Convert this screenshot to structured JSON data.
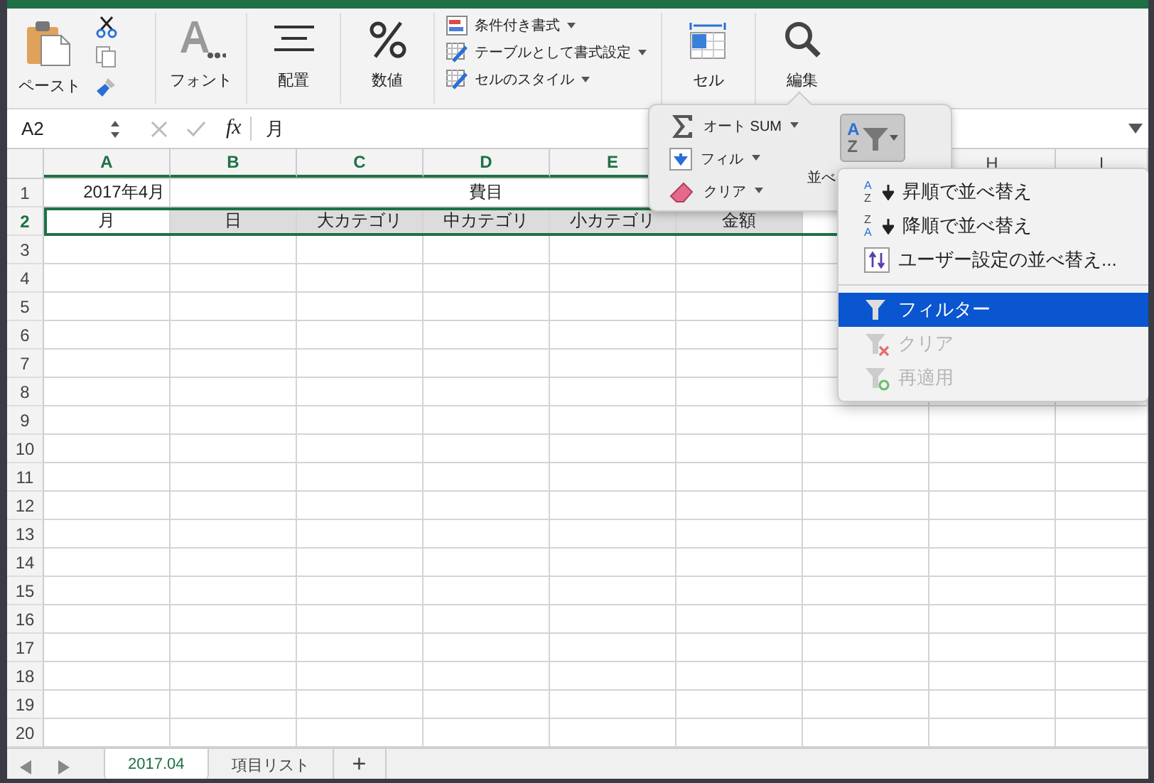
{
  "ribbon": {
    "groups": [
      {
        "kind": "paste",
        "label": "ペースト"
      },
      {
        "kind": "font",
        "label": "フォント"
      },
      {
        "kind": "align",
        "label": "配置"
      },
      {
        "kind": "number",
        "label": "数値"
      },
      {
        "kind": "styles",
        "items": [
          {
            "kind": "conditional",
            "label": "条件付き書式"
          },
          {
            "kind": "table",
            "label": "テーブルとして書式設定"
          },
          {
            "kind": "cellstyle",
            "label": "セルのスタイル"
          }
        ]
      },
      {
        "kind": "cells",
        "label": "セル"
      },
      {
        "kind": "edit",
        "label": "編集"
      }
    ]
  },
  "formula_bar": {
    "name_box": "A2",
    "fx": "fx",
    "value": "月"
  },
  "sheet": {
    "columns": [
      {
        "label": "A",
        "selected": true
      },
      {
        "label": "B",
        "selected": true
      },
      {
        "label": "C",
        "selected": true
      },
      {
        "label": "D",
        "selected": true
      },
      {
        "label": "E",
        "selected": true
      },
      {},
      {},
      {
        "label": "H",
        "selected": false
      },
      {
        "label": "I",
        "selected": false
      }
    ],
    "rows": [
      {
        "number": "1",
        "selected": false,
        "cells": [
          {
            "text": "2017年4月",
            "kind": "right",
            "highlighted": false
          },
          {
            "text": "費目",
            "kind": "merged",
            "highlighted": false
          }
        ]
      },
      {
        "number": "2",
        "selected": true,
        "cells": [
          {
            "text": "月",
            "kind": "center",
            "highlighted": false
          },
          {
            "text": "日",
            "kind": "center",
            "highlighted": true
          },
          {
            "text": "大カテゴリ",
            "kind": "center",
            "highlighted": true
          },
          {
            "text": "中カテゴリ",
            "kind": "center",
            "highlighted": true
          },
          {
            "text": "小カテゴリ",
            "kind": "center",
            "highlighted": true
          },
          {
            "text": "金額",
            "kind": "center",
            "highlighted": true
          }
        ]
      },
      {
        "number": "3",
        "selected": false
      },
      {
        "number": "4",
        "selected": false
      },
      {
        "number": "5",
        "selected": false
      },
      {
        "number": "6",
        "selected": false
      },
      {
        "number": "7",
        "selected": false
      },
      {
        "number": "8",
        "selected": false
      },
      {
        "number": "9",
        "selected": false
      },
      {
        "number": "10",
        "selected": false
      },
      {
        "number": "11",
        "selected": false
      },
      {
        "number": "12",
        "selected": false
      },
      {
        "number": "13",
        "selected": false
      },
      {
        "number": "14",
        "selected": false
      },
      {
        "number": "15",
        "selected": false
      },
      {
        "number": "16",
        "selected": false
      },
      {
        "number": "17",
        "selected": false
      },
      {
        "number": "18",
        "selected": false
      },
      {
        "number": "19",
        "selected": false
      },
      {
        "number": "20",
        "selected": false
      }
    ]
  },
  "edit_popup": {
    "items": [
      {
        "kind": "sum",
        "label": "オート SUM"
      },
      {
        "kind": "fill",
        "label": "フィル"
      },
      {
        "kind": "clear",
        "label": "クリア"
      }
    ],
    "sort_filter": {
      "label": "並べ",
      "pressed": true,
      "icon_letters": [
        "A",
        "Z"
      ]
    }
  },
  "sort_menu": {
    "sections": [
      [
        {
          "kind": "asc",
          "icon_letters": [
            "A",
            "Z"
          ],
          "label": "昇順で並べ替え",
          "selected": false,
          "disabled": false
        },
        {
          "kind": "desc",
          "icon_letters": [
            "Z",
            "A"
          ],
          "label": "降順で並べ替え",
          "selected": false,
          "disabled": false
        },
        {
          "kind": "custom",
          "label": "ユーザー設定の並べ替え...",
          "selected": false,
          "disabled": false
        }
      ],
      [
        {
          "kind": "filter",
          "label": "フィルター",
          "selected": true,
          "disabled": false
        },
        {
          "kind": "clearfilter",
          "label": "クリア",
          "selected": false,
          "disabled": true
        },
        {
          "kind": "reapply",
          "label": "再適用",
          "selected": false,
          "disabled": true
        }
      ]
    ]
  },
  "sheet_tabs": {
    "tabs": [
      {
        "label": "2017.04",
        "selected": true
      },
      {
        "label": "項目リスト",
        "selected": false
      }
    ],
    "add": "+"
  }
}
